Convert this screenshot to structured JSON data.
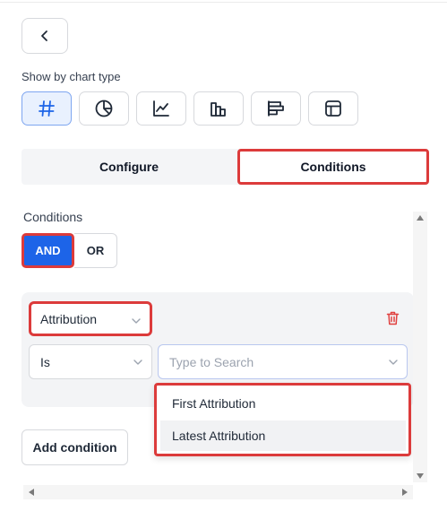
{
  "header": {
    "back_icon": "chevron-left-icon"
  },
  "chart_type": {
    "label": "Show by chart type",
    "options": [
      {
        "icon": "hash-icon",
        "active": true
      },
      {
        "icon": "pie-chart-icon",
        "active": false
      },
      {
        "icon": "line-chart-icon",
        "active": false
      },
      {
        "icon": "bar-chart-icon",
        "active": false
      },
      {
        "icon": "horizontal-bar-chart-icon",
        "active": false
      },
      {
        "icon": "table-icon",
        "active": false
      }
    ]
  },
  "tabs": [
    {
      "label": "Configure",
      "active": false
    },
    {
      "label": "Conditions",
      "active": true
    }
  ],
  "conditions": {
    "label": "Conditions",
    "operators": [
      {
        "label": "AND",
        "active": true
      },
      {
        "label": "OR",
        "active": false
      }
    ],
    "rule": {
      "field": "Attribution",
      "operator": "Is",
      "value_placeholder": "Type to Search",
      "dropdown_options": [
        "First Attribution",
        "Latest Attribution"
      ],
      "hovered_option": "Latest Attribution"
    },
    "add_label": "Add condition"
  },
  "colors": {
    "accent": "#1d64e8",
    "highlight_outline": "#dc3b3b",
    "delete_icon": "#e0403f",
    "active_chart_bg": "#e9f1fe"
  }
}
